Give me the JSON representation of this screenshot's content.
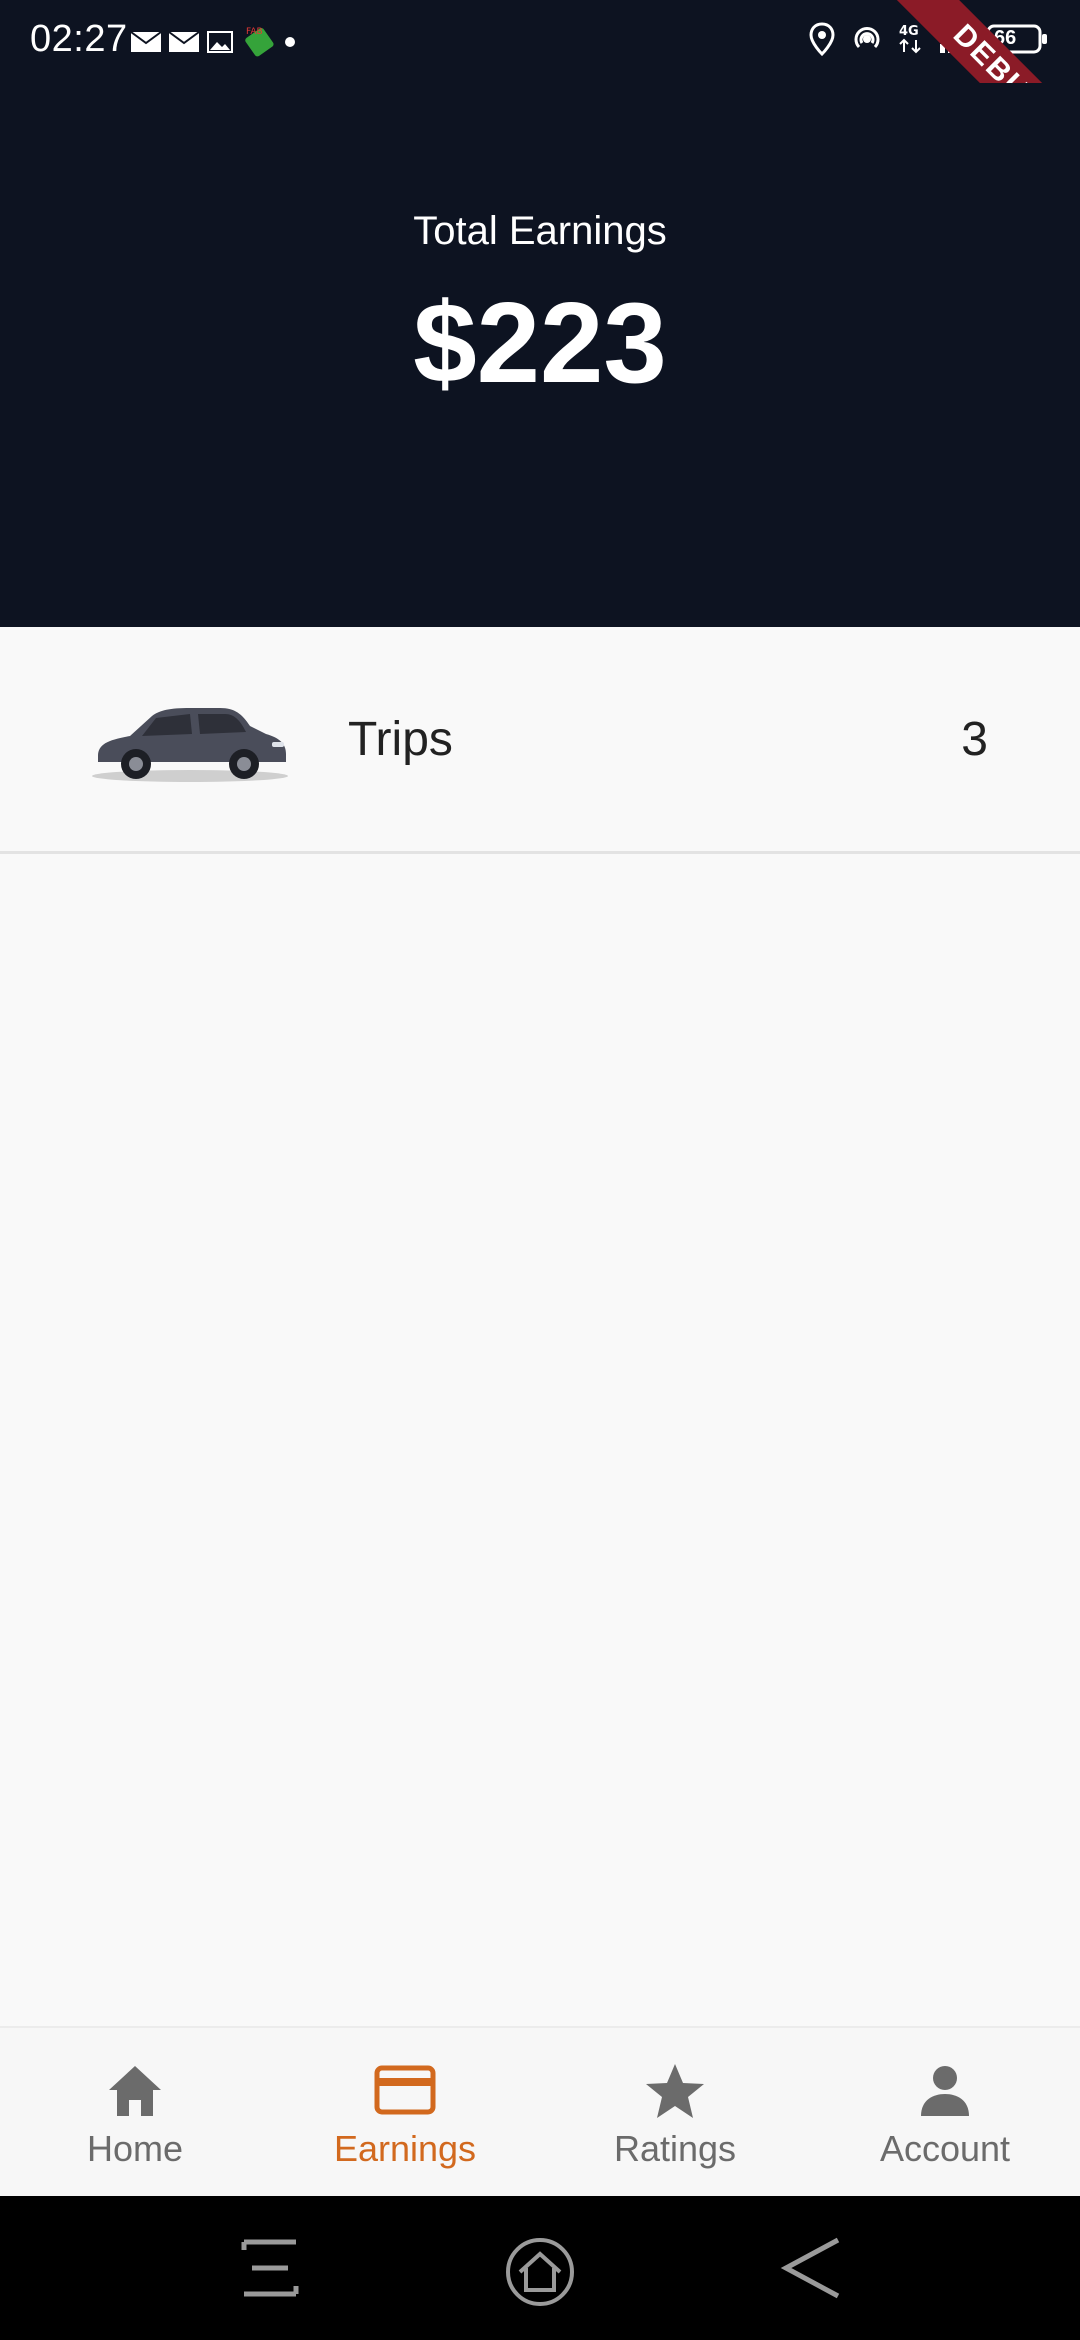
{
  "status_bar": {
    "time": "02:27",
    "battery": "66",
    "network": "4G",
    "left_icons": [
      "mail-icon",
      "mail-icon",
      "image-icon",
      "fab-notification-icon",
      "dot-icon"
    ],
    "right_icons": [
      "location-icon",
      "hotspot-icon",
      "network-4g-icon",
      "signal-icon",
      "battery-icon"
    ]
  },
  "debug_banner": "DEBUG",
  "header": {
    "label": "Total Earnings",
    "amount": "$223"
  },
  "trips": {
    "label": "Trips",
    "count": "3",
    "image": "car-icon"
  },
  "bottom_nav": {
    "active": "Earnings",
    "accent_color": "#d2691e",
    "inactive_color": "#6b6b6b",
    "items": [
      {
        "label": "Home",
        "icon": "home-icon"
      },
      {
        "label": "Earnings",
        "icon": "credit-card-icon"
      },
      {
        "label": "Ratings",
        "icon": "star-icon"
      },
      {
        "label": "Account",
        "icon": "person-icon"
      }
    ]
  },
  "system_nav": {
    "buttons": [
      "menu-icon",
      "home-circle-icon",
      "back-icon"
    ]
  },
  "colors": {
    "header_bg": "#0d1321",
    "page_bg": "#f9f9f9",
    "debug_ribbon": "#8b1b27"
  }
}
